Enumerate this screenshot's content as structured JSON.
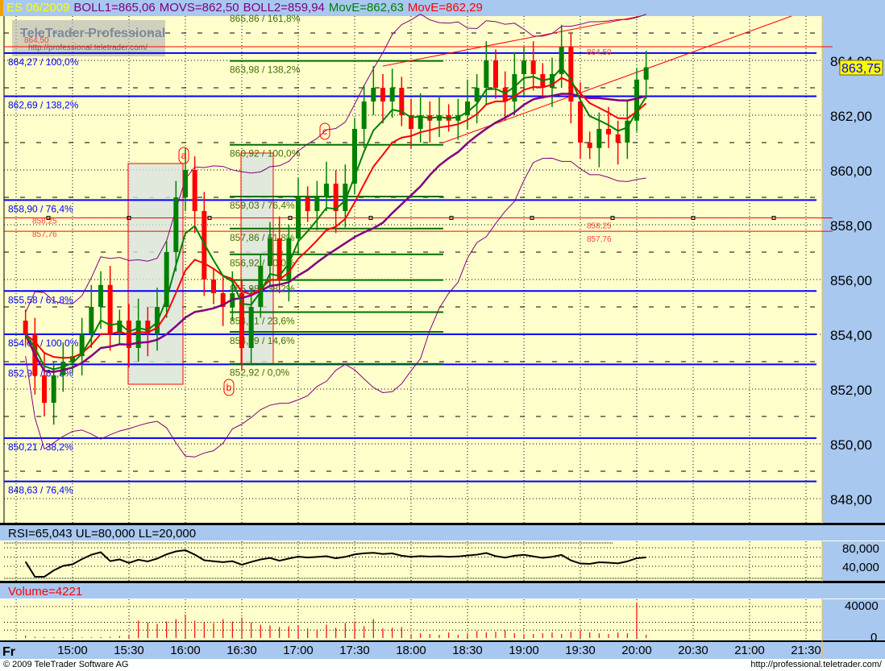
{
  "header": {
    "symbol": "ES 06/2009",
    "boll1": "BOLL1=865,06",
    "movs": "MOVS=862,50",
    "boll2": "BOLL2=859,94",
    "move_green": "MovE=862,63",
    "move_red": "MovE=862,29"
  },
  "logo": {
    "title": "TeleTrader Professional",
    "url": "http://professional.teletrader.com/"
  },
  "colors": {
    "bg": "#ffffcc",
    "panel": "#a8c8f0",
    "up": "#008000",
    "down": "#ff0000",
    "boll": "#800080",
    "fib_blue": "#0000ff",
    "fib_green": "#007000"
  },
  "last_price": "863,75",
  "rsi": {
    "label": "RSI=65,043 UL=80,000 LL=20,000",
    "ticks": [
      "80,000",
      "40,000"
    ]
  },
  "volume": {
    "label": "Volume=4221",
    "ticks": [
      "40000",
      "0"
    ]
  },
  "time_axis": {
    "day": "Fr",
    "ticks": [
      "15:00",
      "15:30",
      "16:00",
      "16:30",
      "17:00",
      "17:30",
      "18:00",
      "18:30",
      "19:00",
      "19:30",
      "20:00",
      "20:30",
      "21:00",
      "21:30"
    ]
  },
  "footer": {
    "copyright": "© 2009 TeleTrader Software AG",
    "url": "http://professional.teletrader.com/"
  },
  "chart_data": {
    "type": "candlestick",
    "title": "ES 06/2009",
    "x_start": "14:35",
    "interval_minutes": 5,
    "closes": [
      854.0,
      852.5,
      851.5,
      852.5,
      853.0,
      853.2,
      854.0,
      855.0,
      855.8,
      854.0,
      854.5,
      853.5,
      854.5,
      854.0,
      855.0,
      857.0,
      859.0,
      860.0,
      858.5,
      856.0,
      855.5,
      855.0,
      855.5,
      853.5,
      855.0,
      856.5,
      857.5,
      856.0,
      857.5,
      859.0,
      858.5,
      859.0,
      859.5,
      858.5,
      859.5,
      861.5,
      862.5,
      863.0,
      862.5,
      863.0,
      862.0,
      861.5,
      862.0,
      861.8,
      862.0,
      861.8,
      862.0,
      862.5,
      863.0,
      864.0,
      863.0,
      862.5,
      863.5,
      864.0,
      863.5,
      863.0,
      863.5,
      864.5,
      862.5,
      861.0,
      860.8,
      861.5,
      861.3,
      861.0,
      861.8,
      863.3,
      863.75
    ],
    "volume": [
      3000,
      1500,
      1200,
      1000,
      800,
      900,
      700,
      800,
      1200,
      1500,
      2500,
      3000,
      22000,
      20000,
      18000,
      21000,
      24000,
      30000,
      22000,
      20000,
      19000,
      24000,
      21000,
      26000,
      20000,
      17000,
      16000,
      14000,
      15000,
      16000,
      12000,
      11000,
      17000,
      13000,
      19000,
      21000,
      15000,
      24000,
      12000,
      13000,
      14000,
      5000,
      6000,
      5000,
      4000,
      7000,
      4000,
      6000,
      9000,
      7000,
      8000,
      10000,
      6000,
      5000,
      5000,
      6000,
      7000,
      5000,
      8000,
      10000,
      7000,
      6000,
      5000,
      7000,
      6000,
      45000,
      4221
    ],
    "price_ticks": [
      "864,00",
      "862,00",
      "860,00",
      "858,00",
      "856,00",
      "854,00",
      "852,00",
      "850,00",
      "848,00"
    ],
    "price_tick_values": [
      864,
      862,
      860,
      858,
      856,
      854,
      852,
      850,
      848
    ],
    "blue_fib_levels": [
      {
        "value": 864.27,
        "label": "864,27 / 100,0%"
      },
      {
        "value": 862.69,
        "label": "862,69 / 138,2%"
      },
      {
        "value": 858.9,
        "label": "858,90 / 76,4%"
      },
      {
        "value": 855.58,
        "label": "855,58 / 61,8%"
      },
      {
        "value": 854.0,
        "label": "854,00 / 100,0%"
      },
      {
        "value": 852.9,
        "label": "852,90 / 61,8%"
      },
      {
        "value": 850.21,
        "label": "850,21 / 38,2%"
      },
      {
        "value": 848.63,
        "label": "848,63 / 76,4%"
      }
    ],
    "green_fib_levels": [
      {
        "value": 865.86,
        "label": "865,86 / 161,8%"
      },
      {
        "value": 863.98,
        "label": "863,98 / 138,2%"
      },
      {
        "value": 860.92,
        "label": "860,92 / 100,0%"
      },
      {
        "value": 859.03,
        "label": "859,03 / 76,4%"
      },
      {
        "value": 857.86,
        "label": "857,86 / 61,8%"
      },
      {
        "value": 856.92,
        "label": "856,92 / 50,0%"
      },
      {
        "value": 855.98,
        "label": "855,98 / 38,2%"
      },
      {
        "value": 854.81,
        "label": "854,81 / 23,6%"
      },
      {
        "value": 854.09,
        "label": "854,09 / 14,6%"
      },
      {
        "value": 852.92,
        "label": "852,92 / 0,0%"
      }
    ],
    "red_levels": [
      {
        "value": 864.5,
        "label": "864,50"
      },
      {
        "value": 858.25,
        "label": "858,25"
      },
      {
        "value": 857.76,
        "label": "857,76"
      }
    ],
    "wave_labels": [
      "a",
      "b",
      "c"
    ]
  }
}
